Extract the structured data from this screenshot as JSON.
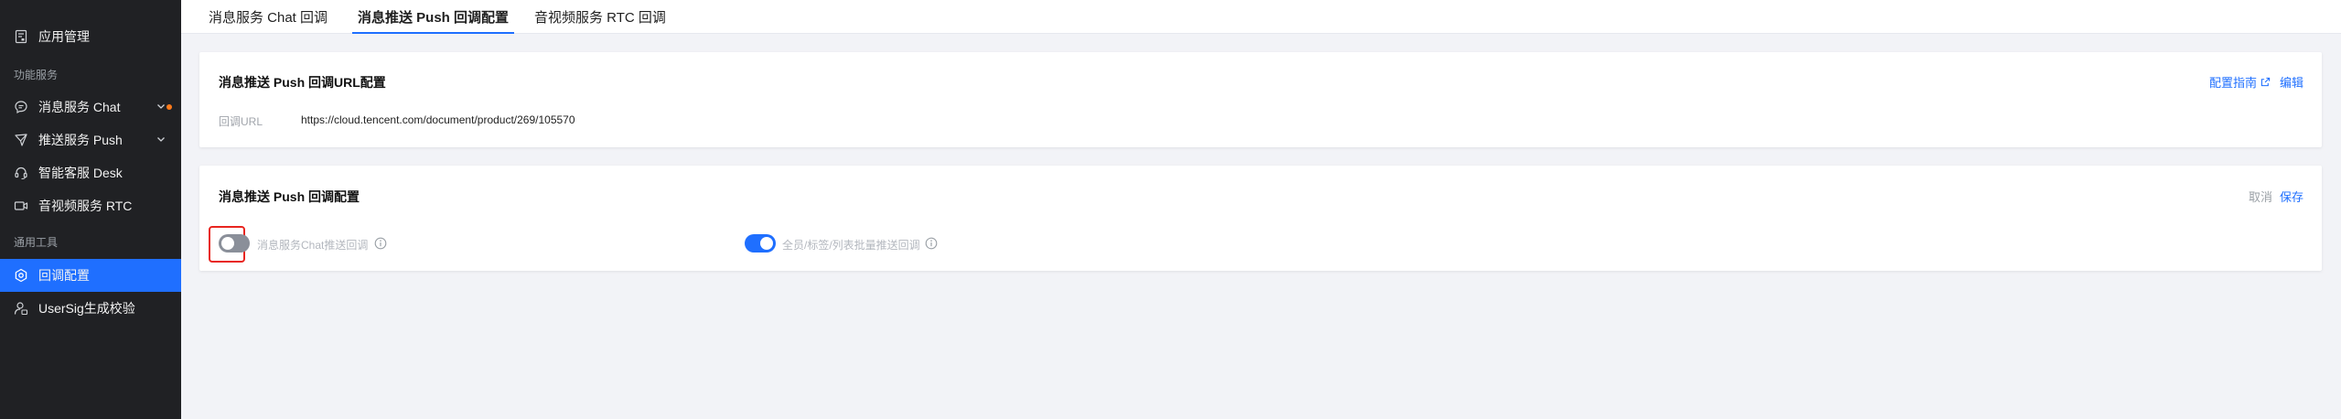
{
  "sidebar": {
    "app_management": "应用管理",
    "group_features": "功能服务",
    "chat": "消息服务 Chat",
    "push": "推送服务 Push",
    "desk": "智能客服 Desk",
    "rtc": "音视频服务 RTC",
    "group_tools": "通用工具",
    "callback_config": "回调配置",
    "usersig": "UserSig生成校验"
  },
  "tabs": {
    "chat_callback": "消息服务 Chat 回调",
    "push_callback": "消息推送 Push 回调配置",
    "rtc_callback": "音视频服务 RTC 回调"
  },
  "url_card": {
    "title": "消息推送 Push 回调URL配置",
    "guide_link": "配置指南",
    "edit_link": "编辑",
    "url_label": "回调URL",
    "url_value": "https://cloud.tencent.com/document/product/269/105570"
  },
  "config_card": {
    "title": "消息推送 Push 回调配置",
    "cancel": "取消",
    "save": "保存",
    "toggle_chat_label": "消息服务Chat推送回调",
    "toggle_chat_on": false,
    "toggle_all_label": "全员/标签/列表批量推送回调",
    "toggle_all_on": true
  },
  "colors": {
    "accent": "#1f6fff",
    "sidebar_bg": "#202124",
    "highlight": "#e8251f",
    "notify_dot": "#ff7a1a"
  }
}
